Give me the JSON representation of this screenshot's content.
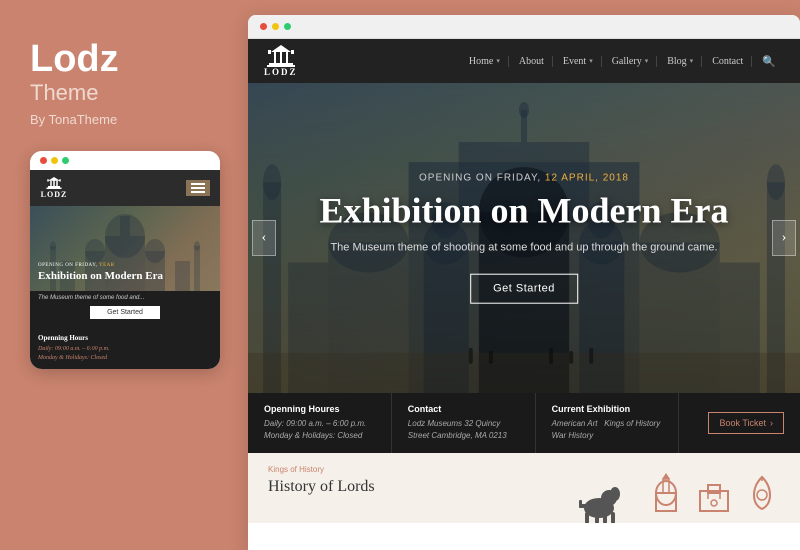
{
  "left": {
    "brand_title": "Lodz",
    "brand_subtitle": "Theme",
    "brand_by": "By TonaTheme",
    "dots": [
      "red",
      "yellow",
      "green"
    ]
  },
  "mobile": {
    "logo_text": "LODZ",
    "opening_label": "OPENING ON FRIDAY,",
    "opening_date": "YEAR",
    "hero_title": "Exhibition on Modern Era",
    "hero_desc": "The Museum theme of some food and...",
    "cta": "Get Started",
    "info_title": "Openning Hours",
    "info_text_1": "Daily: 09:00 a.m. – 6:00 p.m.",
    "info_text_2": "Monday & Holidays: Closed"
  },
  "browser": {
    "dots": [
      "red",
      "yellow",
      "green"
    ],
    "nav": {
      "logo": "LODZ",
      "links": [
        {
          "label": "Home",
          "has_chevron": true
        },
        {
          "label": "About",
          "has_chevron": false
        },
        {
          "label": "Event",
          "has_chevron": true
        },
        {
          "label": "Gallery",
          "has_chevron": true
        },
        {
          "label": "Blog",
          "has_chevron": true
        },
        {
          "label": "Contact",
          "has_chevron": false
        }
      ]
    },
    "hero": {
      "opening_label": "OPENING ON FRIDAY,",
      "opening_date": "12 APRIL, 2018",
      "title": "Exhibition on Modern Era",
      "description": "The Museum theme of shooting at some food and up through the ground came.",
      "cta_label": "Get Started",
      "arrow_left": "‹",
      "arrow_right": "›"
    },
    "info_bar": [
      {
        "title": "Openning Houres",
        "text1": "Daily: 09:00 a.m. – 6:00 p.m.",
        "text2": "Monday & Holidays: Closed"
      },
      {
        "title": "Contact",
        "text1": "Lodz Museums 32 Quincy",
        "text2": "Street Cambridge, MA 0213"
      },
      {
        "title": "Current Exhibition",
        "text1": "American Art   Kings of History",
        "text2": "War History"
      },
      {
        "book_label": "Book Ticket",
        "book_arrow": "›"
      }
    ],
    "bottom": {
      "kings_label": "Kings of History",
      "kings_title": "History of Lords"
    }
  }
}
